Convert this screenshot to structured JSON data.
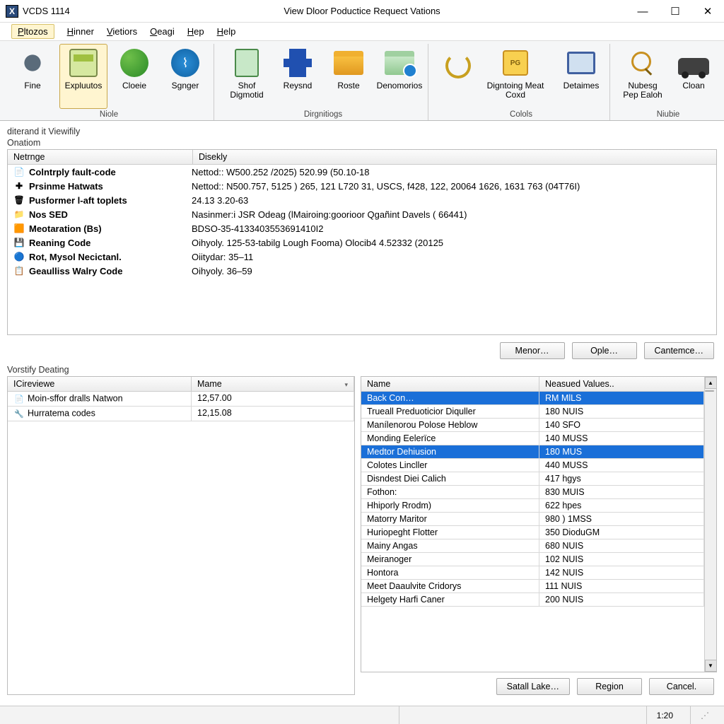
{
  "titlebar": {
    "app_icon_text": "X",
    "app_title": "VCDS 1114",
    "doc_title": "View Dloor Poductice Requect Vations"
  },
  "menubar": {
    "items": [
      "Pltozos",
      "Hinner",
      "Vietiors",
      "Oeagi",
      "Hep",
      "Help"
    ],
    "sel": 0
  },
  "ribbon": {
    "groups": [
      {
        "label": "Niole",
        "buttons": [
          {
            "label": "Fine",
            "icon": "gear",
            "sel": false
          },
          {
            "label": "Expluutos",
            "icon": "cal",
            "sel": true
          },
          {
            "label": "Cloeie",
            "icon": "globe",
            "sel": false
          },
          {
            "label": "Sgnger",
            "icon": "wifi",
            "sel": false
          }
        ]
      },
      {
        "label": "Dirgnitiogs",
        "buttons": [
          {
            "label": "Shof Digmotid",
            "icon": "doc",
            "sel": false
          },
          {
            "label": "Reysnd",
            "icon": "puzzle",
            "sel": false
          },
          {
            "label": "Roste",
            "icon": "folder",
            "sel": false
          },
          {
            "label": "Denomorios",
            "icon": "folder2",
            "sel": false
          }
        ]
      },
      {
        "label": "Colols",
        "buttons": [
          {
            "label": "Digntoing Meat Coxd",
            "icon": "badge",
            "sel": false,
            "wide": true
          },
          {
            "label": "Detaimes",
            "icon": "screen",
            "sel": false
          }
        ],
        "leading_icon": "wrench"
      },
      {
        "label": "Niubie",
        "buttons": [
          {
            "label": "Nubesg Pep Ealoh",
            "icon": "mag",
            "sel": false
          },
          {
            "label": "Cloan",
            "icon": "car",
            "sel": false
          }
        ]
      }
    ]
  },
  "toppanel": {
    "pre_label_a": "diterand it Viewifily",
    "pre_label_b": "Onatiom",
    "col_a": "Netrnge",
    "col_b": "Disekly",
    "rows": [
      {
        "icon": "📄",
        "k": "Colntrply fault-code",
        "v": "Nettod:: W500.252 /2025) 520.99 (50.10-18"
      },
      {
        "icon": "✚",
        "k": "Prsinme Hatwats",
        "v": "Nettod:: N500.757, 5125 ) 265, 121 L720 31, USCS, f428, 122, 20064 1626, 1631 763 (04T76I)"
      },
      {
        "icon": "🗑",
        "k": "Pusformer l-aft toplets",
        "v": "24.13 3.20-63"
      },
      {
        "icon": "📁",
        "k": "Nos SED",
        "v": "Nasinmer:i JSR Odeag (lMairoing:goorioor Qgañint Davels ( 66441)"
      },
      {
        "icon": "🟧",
        "k": "Meotaration (Bs)",
        "v": "BDSO-35-4133403553691410I2"
      },
      {
        "icon": "💾",
        "k": "Reaning Code",
        "v": "Oihyoly. 125-53-tabilg Lough Fooma) Olocib4 4.52332 (20125"
      },
      {
        "icon": "🔵",
        "k": "Rot, Mysol Necictanl.",
        "v": "Oiitydar: 35–11"
      },
      {
        "icon": "📋",
        "k": "Geaulliss Walry Code",
        "v": "Oihyoly. 36–59"
      }
    ]
  },
  "midbuttons": [
    "Menor…",
    "Ople…",
    "Cantemce…"
  ],
  "leftpanel": {
    "label": "Vorstify Deating",
    "col_a": "ICireviewe",
    "col_b": "Mame",
    "rows": [
      {
        "icon": "📄",
        "k": "Moin-sffor dralls Natwon",
        "v": "12,57.00"
      },
      {
        "icon": "🔧",
        "k": "Hurratema codes",
        "v": "12,15.08"
      }
    ]
  },
  "rightpanel": {
    "col_a": "Name",
    "col_b": "Neasued Values..",
    "rows": [
      {
        "n": "Back Con…",
        "v": "RM MlLS",
        "sel": true
      },
      {
        "n": "Trueall Preduoticior Diquller",
        "v": "180 NUIS"
      },
      {
        "n": "Manílenorou Polose Heblow",
        "v": "140 SFO"
      },
      {
        "n": "Monding Eelerïce",
        "v": "140 MUSS"
      },
      {
        "n": "Medtor Dehiusion",
        "v": "180 MUS",
        "sel": true
      },
      {
        "n": "Colotes Lincller",
        "v": "440 MUSS"
      },
      {
        "n": "Disndest Diei Calich",
        "v": "417 hgys"
      },
      {
        "n": "Fothon:",
        "v": "830 MUIS"
      },
      {
        "n": "Hhiporly Rrodm)",
        "v": "622 hpes"
      },
      {
        "n": "Matorry Maritor",
        "v": "980 ) 1MSS"
      },
      {
        "n": "Huriopeght Flotter",
        "v": "350 DioduGM"
      },
      {
        "n": "Mainy Angas",
        "v": "680 NUIS"
      },
      {
        "n": "Meiranoger",
        "v": "102 NUIS"
      },
      {
        "n": "Hontora",
        "v": "142 NUIS"
      },
      {
        "n": "Meet Daaulvite Cridorys",
        "v": "111 NUIS"
      },
      {
        "n": "Helgety Harfi Caner",
        "v": "200 NUIS"
      }
    ]
  },
  "bottombuttons": [
    "Satall Lake…",
    "Region",
    "Cancel."
  ],
  "status": {
    "time": "1:20"
  }
}
